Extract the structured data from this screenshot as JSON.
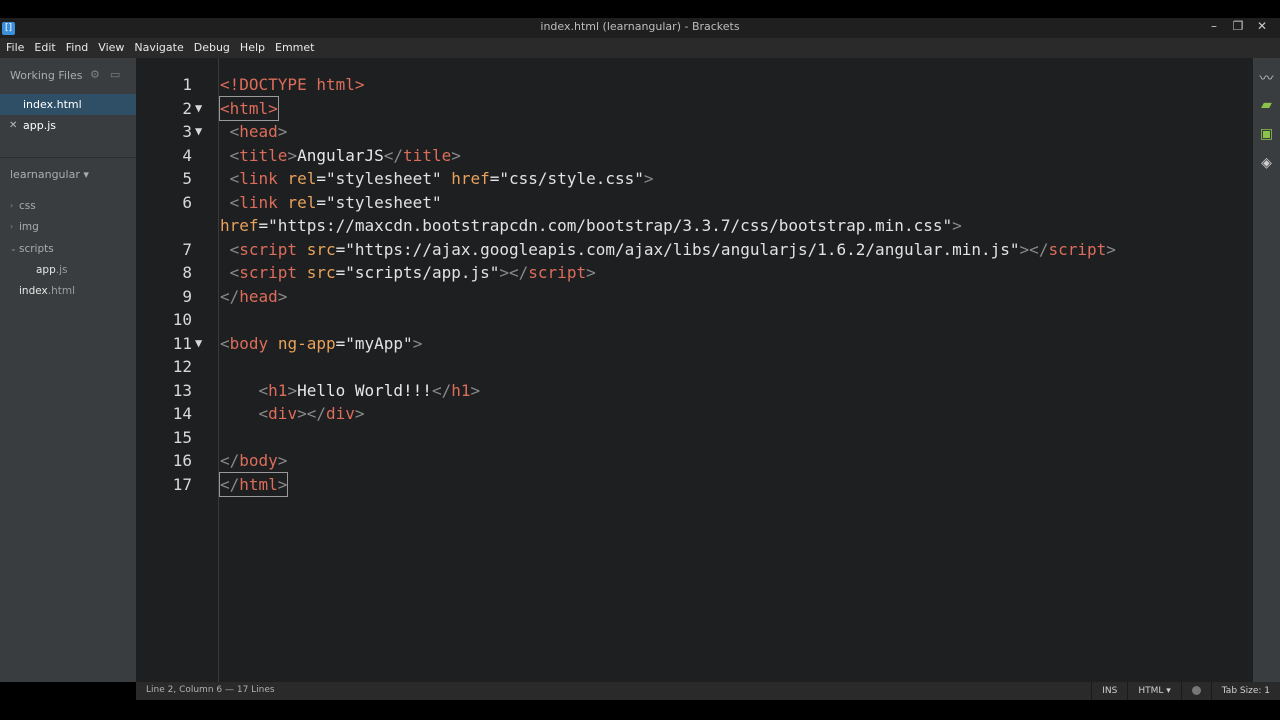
{
  "window": {
    "title": "index.html (learnangular) - Brackets",
    "minimize": "–",
    "maximize": "❐",
    "close": "✕",
    "app_icon": "brackets-icon"
  },
  "menu": [
    "File",
    "Edit",
    "Find",
    "View",
    "Navigate",
    "Debug",
    "Help",
    "Emmet"
  ],
  "sidebar": {
    "working_files_label": "Working Files",
    "working_files": [
      {
        "name": "index.html",
        "active": true
      },
      {
        "name": "app.js",
        "active": false
      }
    ],
    "project_name": "learnangular ▾",
    "tree": [
      {
        "name": "css",
        "type": "folder"
      },
      {
        "name": "img",
        "type": "folder"
      },
      {
        "name": "scripts",
        "type": "folder"
      },
      {
        "name": "app",
        "ext": ".js",
        "type": "file"
      },
      {
        "name": "index",
        "ext": ".html",
        "type": "file"
      }
    ]
  },
  "editor": {
    "lines": [
      {
        "num": "1",
        "fold": "",
        "segments": [
          [
            "dt",
            "<!DOCTYPE html>"
          ]
        ]
      },
      {
        "num": "2",
        "fold": "▼",
        "segments": [
          [
            "tg",
            "<"
          ],
          [
            "tg",
            "html"
          ],
          [
            "tg",
            ">"
          ]
        ],
        "cursor": true
      },
      {
        "num": "3",
        "fold": "▼",
        "segments": [
          [
            "b",
            " <"
          ],
          [
            "tg",
            "head"
          ],
          [
            "b",
            ">"
          ]
        ]
      },
      {
        "num": "4",
        "fold": "",
        "segments": [
          [
            "b",
            " <"
          ],
          [
            "tg",
            "title"
          ],
          [
            "b",
            ">"
          ],
          [
            "t",
            "AngularJS"
          ],
          [
            "b",
            "</"
          ],
          [
            "tg",
            "title"
          ],
          [
            "b",
            ">"
          ]
        ]
      },
      {
        "num": "5",
        "fold": "",
        "segments": [
          [
            "b",
            " <"
          ],
          [
            "tg",
            "link "
          ],
          [
            "at",
            "rel"
          ],
          [
            "t",
            "="
          ],
          [
            "s",
            "\"stylesheet\" "
          ],
          [
            "at",
            "href"
          ],
          [
            "t",
            "="
          ],
          [
            "s",
            "\"css/style.css\""
          ],
          [
            "b",
            ">"
          ]
        ]
      },
      {
        "num": "6",
        "fold": "",
        "segments": [
          [
            "b",
            " <"
          ],
          [
            "tg",
            "link "
          ],
          [
            "at",
            "rel"
          ],
          [
            "t",
            "="
          ],
          [
            "s",
            "\"stylesheet\""
          ]
        ]
      },
      {
        "num": "",
        "fold": "",
        "segments": [
          [
            "at",
            "href"
          ],
          [
            "t",
            "="
          ],
          [
            "s",
            "\"https://maxcdn.bootstrapcdn.com/bootstrap/3.3.7/css/bootstrap.min.css\""
          ],
          [
            "b",
            ">"
          ]
        ]
      },
      {
        "num": "7",
        "fold": "",
        "segments": [
          [
            "b",
            " <"
          ],
          [
            "tg",
            "script "
          ],
          [
            "at",
            "src"
          ],
          [
            "t",
            "="
          ],
          [
            "s",
            "\"https://ajax.googleapis.com/ajax/libs/angularjs/1.6.2/angular.min.js\""
          ],
          [
            "b",
            "></"
          ],
          [
            "tg",
            "script"
          ],
          [
            "b",
            ">"
          ]
        ]
      },
      {
        "num": "8",
        "fold": "",
        "segments": [
          [
            "b",
            " <"
          ],
          [
            "tg",
            "script "
          ],
          [
            "at",
            "src"
          ],
          [
            "t",
            "="
          ],
          [
            "s",
            "\"scripts/app.js\""
          ],
          [
            "b",
            "></"
          ],
          [
            "tg",
            "script"
          ],
          [
            "b",
            ">"
          ]
        ]
      },
      {
        "num": "9",
        "fold": "",
        "segments": [
          [
            "b",
            "</"
          ],
          [
            "tg",
            "head"
          ],
          [
            "b",
            ">"
          ]
        ]
      },
      {
        "num": "10",
        "fold": "",
        "segments": []
      },
      {
        "num": "11",
        "fold": "▼",
        "segments": [
          [
            "b",
            "<"
          ],
          [
            "tg",
            "body "
          ],
          [
            "at",
            "ng-app"
          ],
          [
            "t",
            "="
          ],
          [
            "s",
            "\"myApp\""
          ],
          [
            "b",
            ">"
          ]
        ]
      },
      {
        "num": "12",
        "fold": "",
        "segments": []
      },
      {
        "num": "13",
        "fold": "",
        "segments": [
          [
            "b",
            "    <"
          ],
          [
            "tg",
            "h1"
          ],
          [
            "b",
            ">"
          ],
          [
            "t",
            "Hello World!!!"
          ],
          [
            "b",
            "</"
          ],
          [
            "tg",
            "h1"
          ],
          [
            "b",
            ">"
          ]
        ]
      },
      {
        "num": "14",
        "fold": "",
        "segments": [
          [
            "b",
            "    <"
          ],
          [
            "tg",
            "div"
          ],
          [
            "b",
            "></"
          ],
          [
            "tg",
            "div"
          ],
          [
            "b",
            ">"
          ]
        ]
      },
      {
        "num": "15",
        "fold": "",
        "segments": []
      },
      {
        "num": "16",
        "fold": "",
        "segments": [
          [
            "b",
            "</"
          ],
          [
            "tg",
            "body"
          ],
          [
            "b",
            ">"
          ]
        ]
      },
      {
        "num": "17",
        "fold": "",
        "segments": [
          [
            "b",
            "</"
          ],
          [
            "tg",
            "html"
          ],
          [
            "b",
            ">"
          ]
        ],
        "box": true
      }
    ]
  },
  "right_rail": [
    "live-preview-icon",
    "extension-manager-icon",
    "extension-icon",
    "layers-icon"
  ],
  "status": {
    "position": "Line 2, Column 6 — 17 Lines",
    "mode": "INS",
    "language": "HTML ▾",
    "tab_size": "Tab Size: 1"
  }
}
